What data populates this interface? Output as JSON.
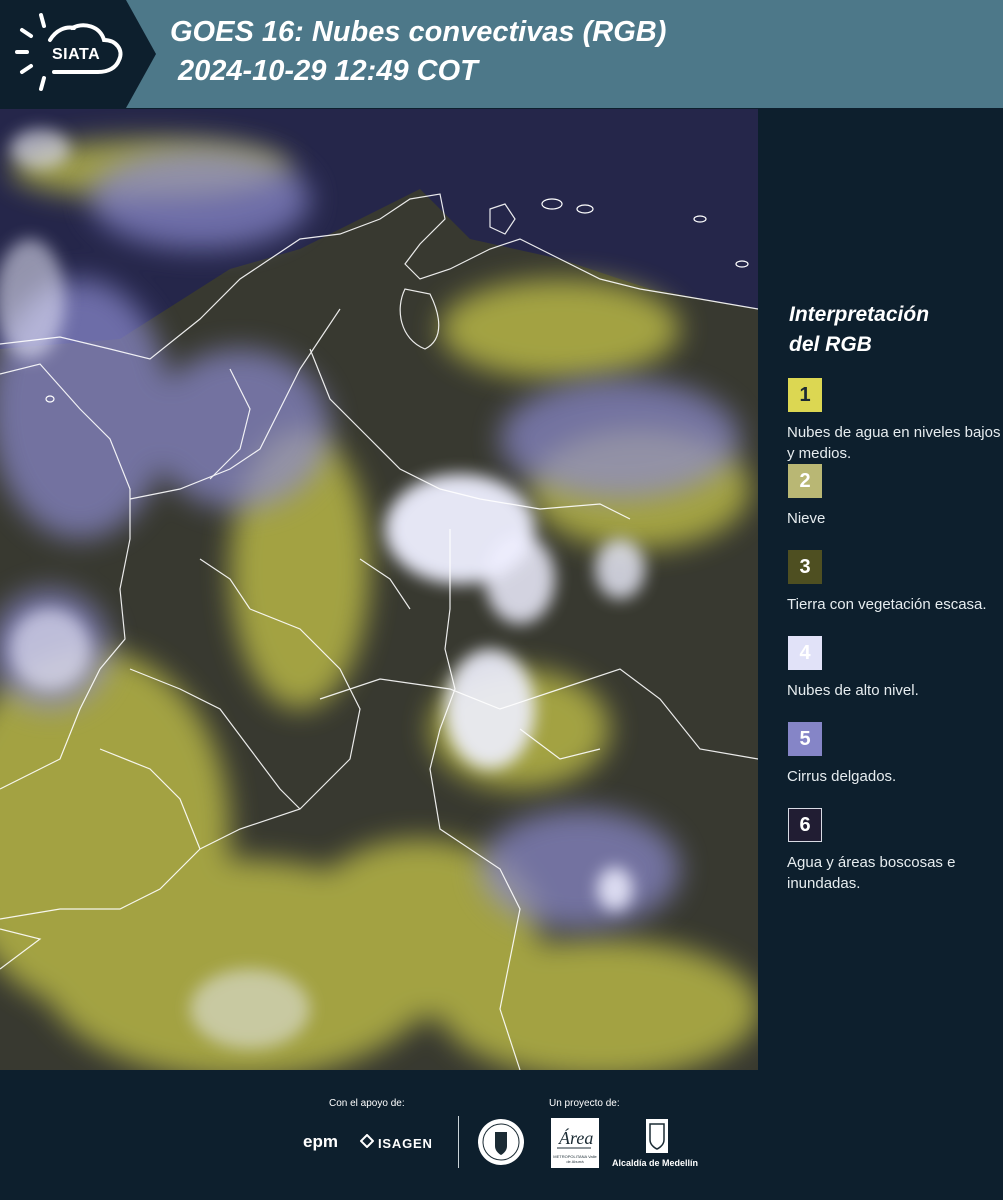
{
  "header": {
    "logo_text": "SIATA",
    "title_line1": "GOES 16: Nubes convectivas (RGB)",
    "title_line2": "2024-10-29 12:49 COT",
    "background_color": "#4d7889",
    "logo_background_color": "#0d1f2d"
  },
  "map": {
    "icon": "satellite-rgb-map",
    "ocean_color": "#25264a",
    "low_cloud_color": "#d9d84a",
    "high_cloud_color": "#ecebff",
    "boundary_color": "#ffffff"
  },
  "legend": {
    "title_line1": "Interpretación",
    "title_line2": "del RGB",
    "items": [
      {
        "number": "1",
        "color": "#dcd752",
        "label": "Nubes de agua en niveles bajos y medios."
      },
      {
        "number": "2",
        "color": "#b9b774",
        "label": "Nieve"
      },
      {
        "number": "3",
        "color": "#4e4f21",
        "label": "Tierra con vegetación escasa."
      },
      {
        "number": "4",
        "color": "#e1e2f8",
        "label": "Nubes de alto nivel."
      },
      {
        "number": "5",
        "color": "#8585c7",
        "label": "Cirrus delgados."
      },
      {
        "number": "6",
        "color": "#211d33",
        "label": "Agua y áreas boscosas e inundadas."
      }
    ]
  },
  "footer": {
    "support_label": "Con el apoyo de:",
    "project_label": "Un proyecto de:",
    "sponsors": [
      "epm",
      "ISAGEN"
    ],
    "partners": {
      "area_metropolitana": "Área",
      "area_subtitle": "METROPOLITANA Valle de Aburrá",
      "alcaldia": "Alcaldía de Medellín"
    }
  }
}
